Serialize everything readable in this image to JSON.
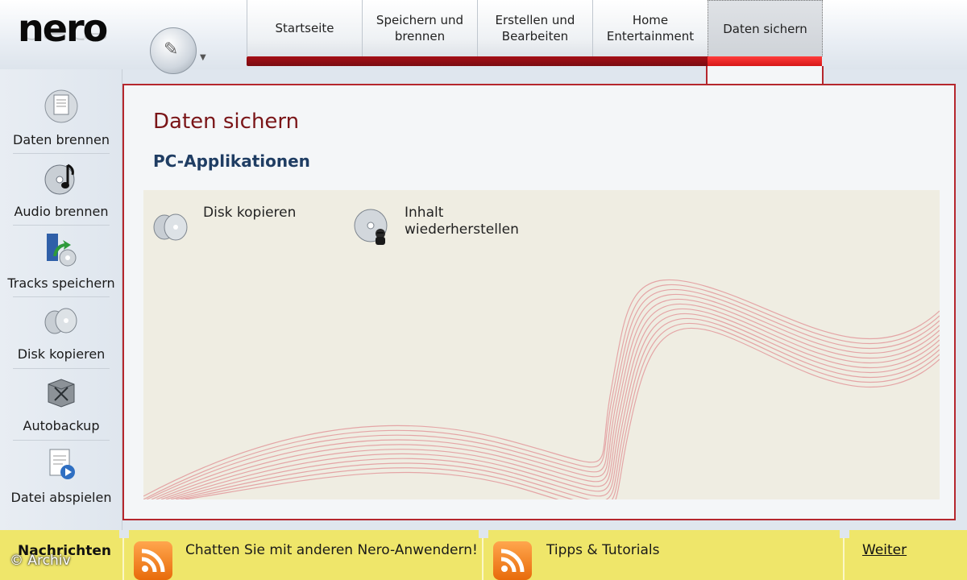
{
  "brand": {
    "logo": "nero"
  },
  "tabs": [
    {
      "label": "Startseite"
    },
    {
      "label": "Speichern und brennen"
    },
    {
      "label": "Erstellen und Bearbeiten"
    },
    {
      "label": "Home Entertainment"
    },
    {
      "label": "Daten sichern",
      "active": true
    }
  ],
  "sidebar": {
    "items": [
      {
        "label": "Daten brennen",
        "icon": "data-disc-icon"
      },
      {
        "label": "Audio brennen",
        "icon": "music-disc-icon"
      },
      {
        "label": "Tracks speichern",
        "icon": "rip-tracks-icon"
      },
      {
        "label": "Disk kopieren",
        "icon": "copy-disc-icon"
      },
      {
        "label": "Autobackup",
        "icon": "backup-box-icon"
      },
      {
        "label": "Datei abspielen",
        "icon": "play-file-icon"
      }
    ]
  },
  "main": {
    "title": "Daten sichern",
    "section": "PC-Applikationen",
    "apps": [
      {
        "label": "Disk kopieren",
        "icon": "copy-disc-icon"
      },
      {
        "label": "Inhalt wiederherstellen",
        "icon": "restore-disc-icon"
      }
    ]
  },
  "bottom": {
    "news_label": "Nachrichten",
    "feeds": [
      {
        "label": "Chatten Sie mit anderen Nero-Anwendern!",
        "icon": "rss-icon"
      },
      {
        "label": "Tipps & Tutorials",
        "icon": "rss-icon"
      }
    ],
    "more": "Weiter"
  },
  "watermark": "© Archiv",
  "colors": {
    "accent_red": "#b5272d",
    "title_red": "#7a1518",
    "section_blue": "#1f3d63",
    "news_yellow": "#efe66a"
  }
}
